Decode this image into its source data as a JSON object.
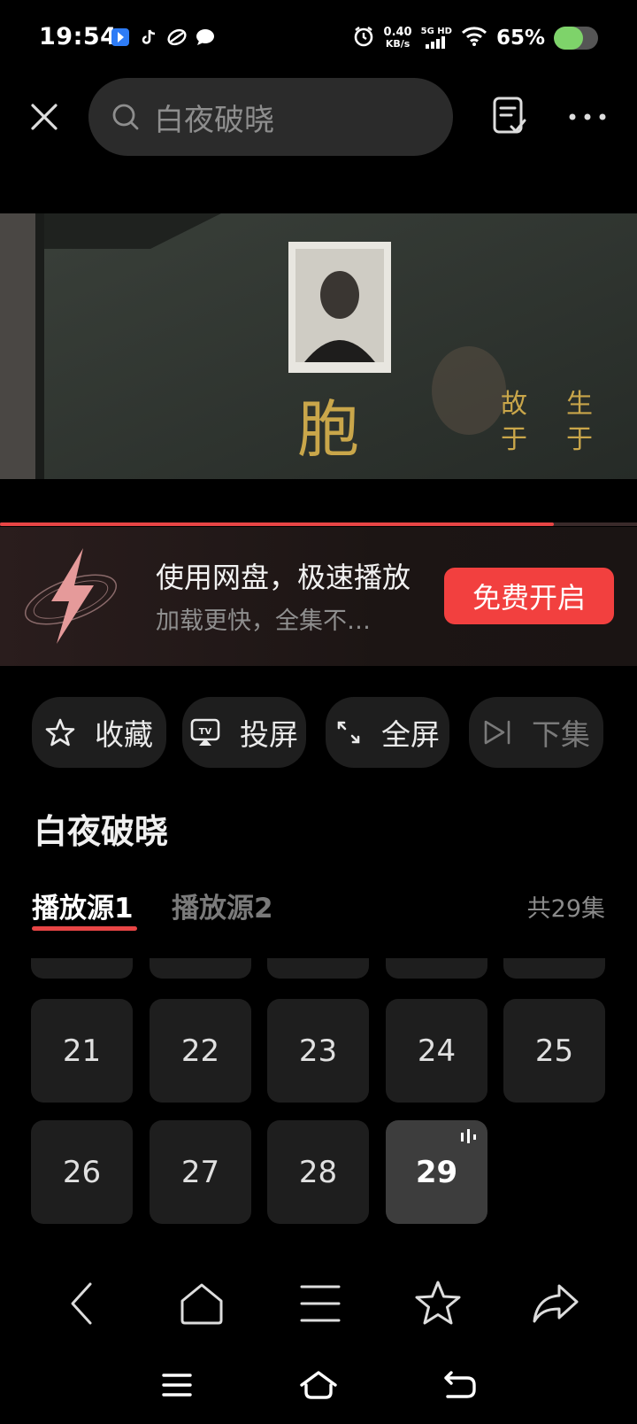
{
  "status_bar": {
    "time": "19:54",
    "net_speed_value": "0.40",
    "net_speed_unit": "KB/s",
    "signal_label": "5G HD",
    "battery_percent": "65%",
    "battery_level": 0.65,
    "notification_icons": [
      "maps-icon",
      "tiktok-icon",
      "app-icon",
      "chat-icon"
    ]
  },
  "search": {
    "query": "白夜破晓"
  },
  "video": {
    "progress": 0.87,
    "frame_text_left": "胞",
    "frame_text_right_col1": "故于",
    "frame_text_right_col2": "生于"
  },
  "promo": {
    "title": "使用网盘，极速播放",
    "subtitle": "加载更快，全集不…",
    "button": "免费开启"
  },
  "actions": [
    {
      "label": "收藏",
      "icon": "star-icon"
    },
    {
      "label": "投屏",
      "icon": "tv-cast-icon"
    },
    {
      "label": "全屏",
      "icon": "fullscreen-icon"
    },
    {
      "label": "下集",
      "icon": "next-episode-icon"
    }
  ],
  "show": {
    "title": "白夜破晓"
  },
  "sources": {
    "tabs": [
      "播放源1",
      "播放源2"
    ],
    "active": 0,
    "episode_count": "共29集"
  },
  "episodes": {
    "row1": [
      "21",
      "22",
      "23",
      "24",
      "25"
    ],
    "row2": [
      "26",
      "27",
      "28",
      "29"
    ],
    "current": "29"
  },
  "toolbar": [
    "back-icon",
    "home-icon",
    "menu-icon",
    "star-icon",
    "share-icon"
  ],
  "system_nav": [
    "menu-icon",
    "home-icon",
    "back-icon"
  ],
  "colors": {
    "accent": "#e84545",
    "button_red": "#f2403f",
    "chip_bg": "#1e1e1e"
  }
}
